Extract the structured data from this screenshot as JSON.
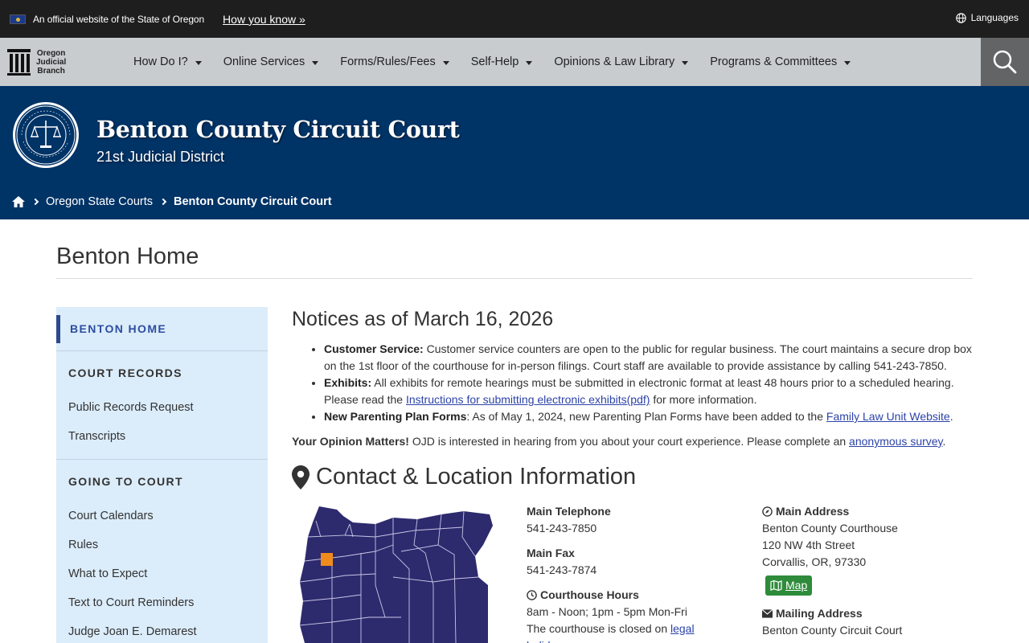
{
  "official": {
    "text": "An official website of the State of Oregon",
    "how_link": "How you know »",
    "languages": "Languages"
  },
  "nav": {
    "logo_line1": "Oregon",
    "logo_line2": "Judicial",
    "logo_line3": "Branch",
    "items": [
      {
        "label": "How Do I?"
      },
      {
        "label": "Online Services"
      },
      {
        "label": "Forms/Rules/Fees"
      },
      {
        "label": "Self-Help"
      },
      {
        "label": "Opinions & Law Library"
      },
      {
        "label": "Programs & Committees"
      }
    ]
  },
  "banner": {
    "title": "Benton County Circuit Court",
    "district": "21st Judicial District",
    "breadcrumb_1": "Oregon State Courts",
    "breadcrumb_2": "Benton County Circuit Court"
  },
  "page": {
    "title": "Benton Home"
  },
  "sidebar": {
    "home": "BENTON HOME",
    "sections": [
      {
        "heading": "COURT RECORDS",
        "links": [
          "Public Records Request",
          "Transcripts"
        ]
      },
      {
        "heading": "GOING TO COURT",
        "links": [
          "Court Calendars",
          "Rules",
          "What to Expect",
          "Text to Court Reminders",
          "Judge Joan E. Demarest"
        ]
      }
    ]
  },
  "notices": {
    "title": "Notices as of March 16, 2026",
    "n1_label": "Customer Service:",
    "n1_text": " Customer service counters are open to the public for regular business. The court maintains a secure drop box on the 1st floor of the courthouse for in-person filings. Court staff are available to provide assistance by calling 541-243-7850.",
    "n2_label": "Exhibits:",
    "n2_text": " All exhibits for remote hearings must be submitted in electronic format at least 48 hours prior to a scheduled hearing. Please read the ",
    "n2_link": "Instructions for submitting electronic exhibits(pdf)",
    "n2_tail": " for more information.",
    "n3_label": "New Parenting Plan Forms",
    "n3_text": ": As of May 1, 2024, new Parenting Plan Forms have been added to the ",
    "n3_link": "Family Law Unit Website",
    "n3_tail": ".",
    "opinion_label": "Your Opinion Matters!",
    "opinion_text": " OJD is interested in hearing from you about your court experience.  Please complete an ",
    "opinion_link": "anonymous survey",
    "opinion_tail": "."
  },
  "contact": {
    "title": "Contact & Location Information",
    "tel_label": "Main Telephone",
    "tel": "541-243-7850",
    "fax_label": "Main Fax",
    "fax": "541-243-7874",
    "hours_label": "Courthouse Hours",
    "hours": "8am - Noon; 1pm - 5pm Mon-Fri",
    "closed_text": "The courthouse is closed on ",
    "closed_link": "legal holidays",
    "addr_label": "Main Address",
    "addr_1": "Benton County Courthouse",
    "addr_2": "120 NW 4th Street",
    "addr_3": "Corvallis, OR, 97330",
    "map_btn": "Map",
    "mail_label": "Mailing Address",
    "mail_1": "Benton County Circuit Court"
  },
  "colors": {
    "banner": "#003366",
    "nav": "#c8ccce",
    "sidebar": "#dbecfa",
    "map_fill": "#2e2a6e",
    "map_highlight": "#f08c1c"
  }
}
